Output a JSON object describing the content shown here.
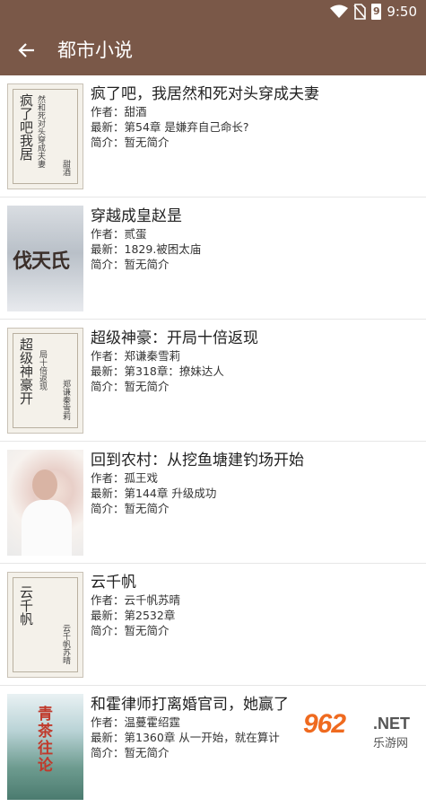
{
  "status": {
    "time": "9:50",
    "battery": "9"
  },
  "header": {
    "title": "都市小说"
  },
  "labels": {
    "author": "作者：",
    "latest": "最新：",
    "intro": "简介："
  },
  "books": [
    {
      "title": "疯了吧，我居然和死对头穿成夫妻",
      "author": "甜酒",
      "latest": "第54章 是嫌弃自己命长?",
      "intro": "暂无简介",
      "cover": {
        "big": "疯了吧我居",
        "small": "然和死对头穿成夫妻",
        "auth": "甜酒"
      }
    },
    {
      "title": "穿越成皇赵昰",
      "author": "贰蛋",
      "latest": "1829.被困太庙",
      "intro": "暂无简介",
      "cover": {
        "text": "伐天氏"
      }
    },
    {
      "title": "超级神豪：开局十倍返现",
      "author": "郑谦秦雪莉",
      "latest": "第318章：撩妹达人",
      "intro": "暂无简介",
      "cover": {
        "big": "超级神豪开",
        "small": "局十倍返现",
        "auth": "郑谦秦雪莉"
      }
    },
    {
      "title": "回到农村：从挖鱼塘建钓场开始",
      "author": "孤王戏",
      "latest": "第144章 升级成功",
      "intro": "暂无简介"
    },
    {
      "title": "云千帆",
      "author": "云千帆苏晴",
      "latest": "第2532章",
      "intro": "暂无简介",
      "cover": {
        "big": "云千帆",
        "auth": "云千帆苏晴"
      }
    },
    {
      "title": "和霍律师打离婚官司，她赢了",
      "author": "温蔓霍绍霆",
      "latest": "第1360章 从一开始，就在算计",
      "intro": "暂无简介",
      "cover": {
        "text": "青茶往论"
      }
    }
  ],
  "watermark": {
    "num": "962",
    "net": ".NET",
    "sub": "乐游网"
  }
}
